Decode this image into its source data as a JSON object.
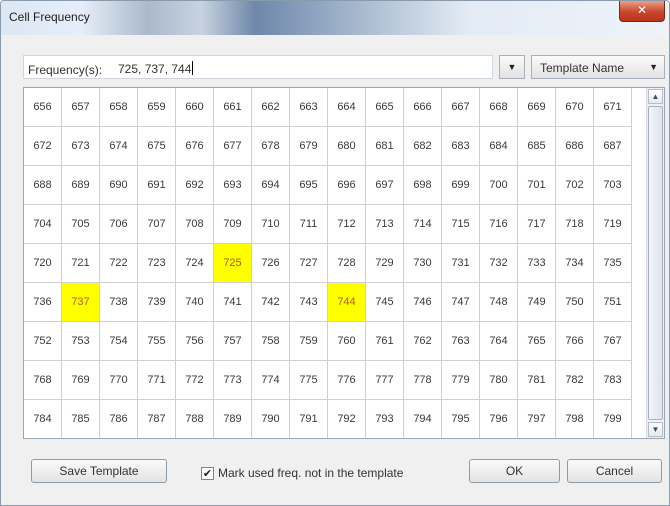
{
  "window": {
    "title": "Cell Frequency",
    "close_glyph": "✕"
  },
  "frequency": {
    "label": "Frequency(s)",
    "value": "725, 737, 744",
    "dropdown_glyph": "▼"
  },
  "template_dropdown": {
    "label": "Template Name",
    "arrow": "▼"
  },
  "grid": {
    "columns": 16,
    "rows": [
      [
        "656",
        "657",
        "658",
        "659",
        "660",
        "661",
        "662",
        "663",
        "664",
        "665",
        "666",
        "667",
        "668",
        "669",
        "670",
        "671"
      ],
      [
        "672",
        "673",
        "674",
        "675",
        "676",
        "677",
        "678",
        "679",
        "680",
        "681",
        "682",
        "683",
        "684",
        "685",
        "686",
        "687"
      ],
      [
        "688",
        "689",
        "690",
        "691",
        "692",
        "693",
        "694",
        "695",
        "696",
        "697",
        "698",
        "699",
        "700",
        "701",
        "702",
        "703"
      ],
      [
        "704",
        "705",
        "706",
        "707",
        "708",
        "709",
        "710",
        "711",
        "712",
        "713",
        "714",
        "715",
        "716",
        "717",
        "718",
        "719"
      ],
      [
        "720",
        "721",
        "722",
        "723",
        "724",
        "725",
        "726",
        "727",
        "728",
        "729",
        "730",
        "731",
        "732",
        "733",
        "734",
        "735"
      ],
      [
        "736",
        "737",
        "738",
        "739",
        "740",
        "741",
        "742",
        "743",
        "744",
        "745",
        "746",
        "747",
        "748",
        "749",
        "750",
        "751"
      ],
      [
        "752",
        "753",
        "754",
        "755",
        "756",
        "757",
        "758",
        "759",
        "760",
        "761",
        "762",
        "763",
        "764",
        "765",
        "766",
        "767"
      ],
      [
        "768",
        "769",
        "770",
        "771",
        "772",
        "773",
        "774",
        "775",
        "776",
        "777",
        "778",
        "779",
        "780",
        "781",
        "782",
        "783"
      ],
      [
        "784",
        "785",
        "786",
        "787",
        "788",
        "789",
        "790",
        "791",
        "792",
        "793",
        "794",
        "795",
        "796",
        "797",
        "798",
        "799"
      ]
    ],
    "highlighted": [
      "725",
      "737",
      "744"
    ],
    "highlight_color": "#ffff00",
    "highlight_text_color": "#b45a00"
  },
  "scrollbar": {
    "up_glyph": "▲",
    "down_glyph": "▼"
  },
  "buttons": {
    "save_template": "Save Template",
    "ok": "OK",
    "cancel": "Cancel"
  },
  "mark_used": {
    "checked": true,
    "check_glyph": "✔",
    "label": "Mark used freq. not in the template"
  }
}
